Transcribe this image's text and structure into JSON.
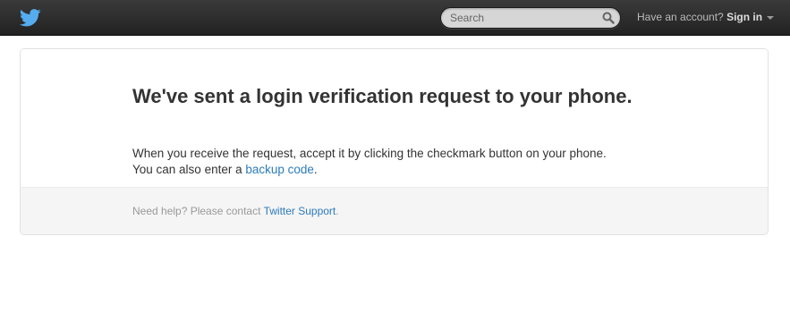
{
  "header": {
    "logo_icon": "twitter-bird-icon",
    "brand_color": "#55acee",
    "search": {
      "placeholder": "Search",
      "icon": "search-icon"
    },
    "account_prompt": "Have an account?",
    "signin_label": "Sign in"
  },
  "card": {
    "heading": "We've sent a login verification request to your phone.",
    "line1": "When you receive the request, accept it by clicking the checkmark button on your phone.",
    "line2_prefix": "You can also enter a ",
    "backup_link": "backup code",
    "line2_suffix": ".",
    "help_prefix": "Need help? Please contact ",
    "support_link": "Twitter Support",
    "help_suffix": "."
  },
  "colors": {
    "link": "#2b7bb9",
    "topbar": "#2a2a2a"
  }
}
